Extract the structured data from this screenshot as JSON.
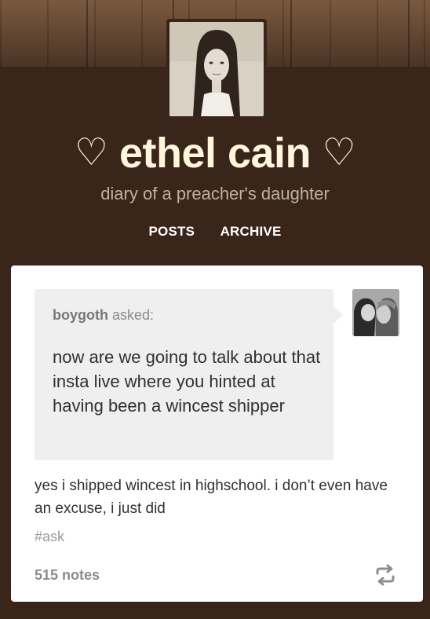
{
  "blog": {
    "heart_left": "♡",
    "title": "ethel cain",
    "heart_right": "♡",
    "description": "diary of a preacher's daughter"
  },
  "nav": {
    "posts": "POSTS",
    "archive": "ARCHIVE"
  },
  "post": {
    "asker": "boygoth",
    "asked_label": " asked:",
    "question": "now are we going to talk about that insta live where you hinted at having been a wincest shipper",
    "answer": "yes i shipped wincest in highschool. i don’t even have an excuse, i just did",
    "tag": "#ask",
    "notes": "515 notes"
  },
  "icons": {
    "reblog": "reblog-icon"
  },
  "colors": {
    "background": "#3a251b",
    "title": "#fff6dc",
    "card": "#ffffff",
    "question_bubble": "#efefef"
  }
}
